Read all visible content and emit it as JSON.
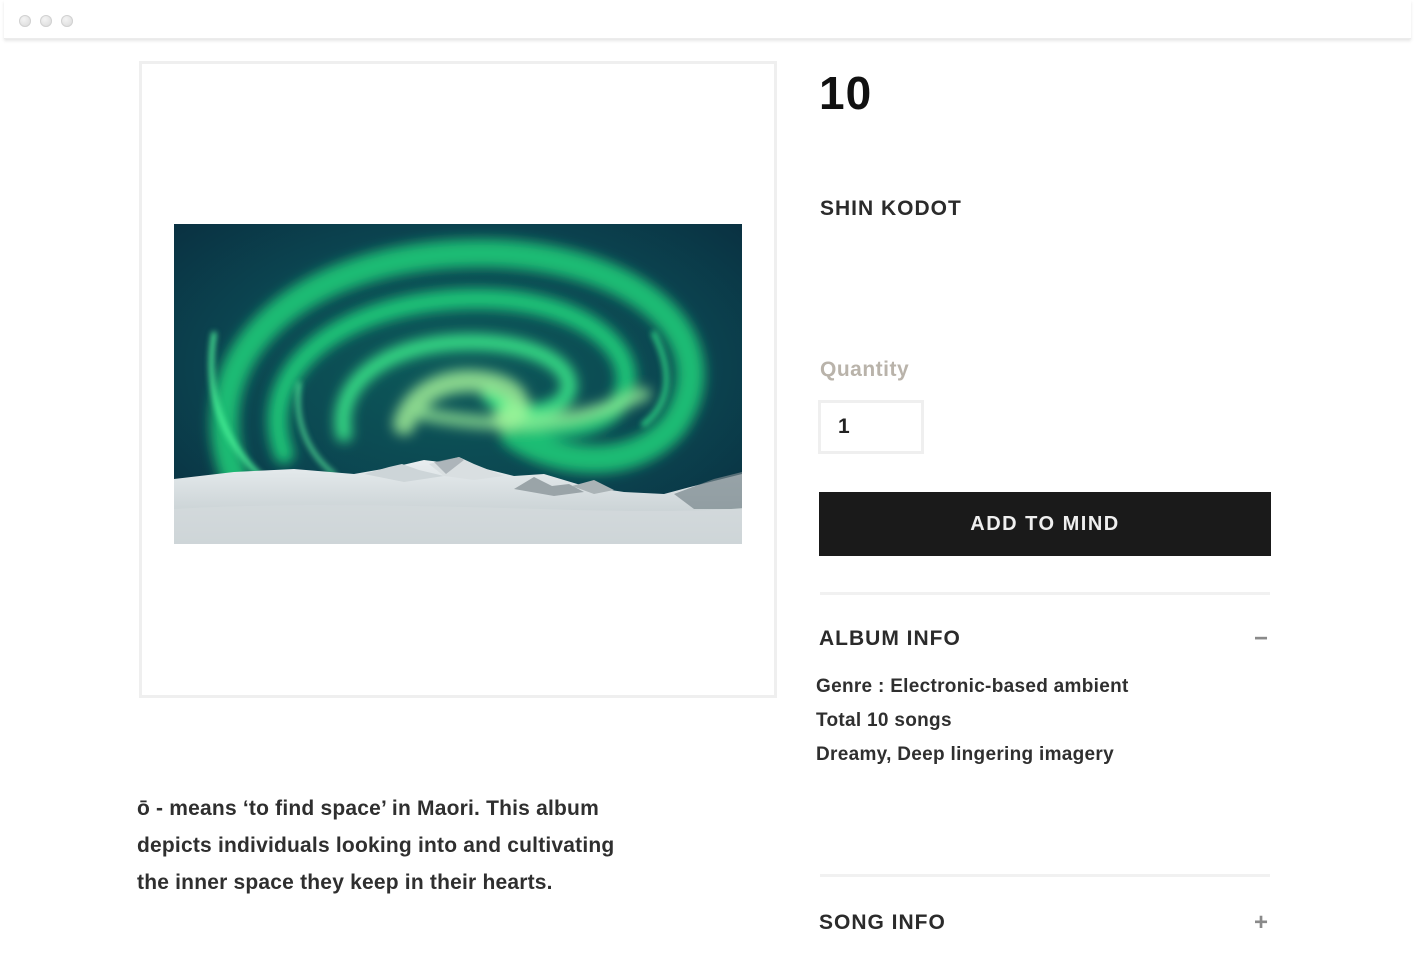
{
  "window": {
    "controls": [
      "close",
      "minimize",
      "maximize"
    ]
  },
  "product": {
    "title": "10",
    "artist": "SHIN KODOT",
    "image": {
      "semantic": "aurora-over-snowy-mountains-album-art"
    },
    "description": [
      "ō - means ‘to find space’ in Maori. This album",
      "depicts individuals looking into and cultivating",
      "the inner space they keep in their hearts."
    ]
  },
  "quantity": {
    "label": "Quantity",
    "value": "1"
  },
  "cart": {
    "button_label": "ADD TO MIND"
  },
  "album_info": {
    "title": "ALBUM INFO",
    "toggle_icon": "minus-icon",
    "toggle_glyph": "−",
    "lines": [
      "Genre : Electronic-based ambient",
      "Total 10 songs",
      "Dreamy, Deep lingering imagery"
    ]
  },
  "song_info": {
    "title": "SONG INFO",
    "toggle_icon": "plus-icon",
    "toggle_glyph": "+"
  }
}
